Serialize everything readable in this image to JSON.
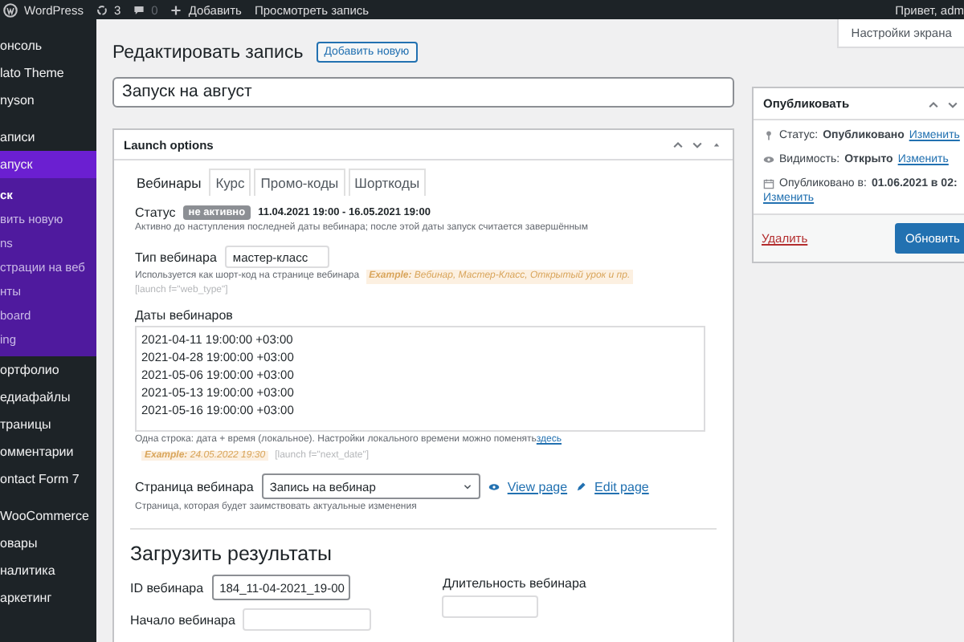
{
  "admin_bar": {
    "site": "WordPress",
    "updates": "3",
    "comments": "0",
    "add": "Добавить",
    "view": "Просмотреть запись",
    "greeting": "Привет, adm"
  },
  "sidebar": {
    "groups": [
      {
        "items": [
          {
            "label": "онсоль",
            "selected": false
          },
          {
            "label": "lato Theme",
            "selected": false
          },
          {
            "label": "nyson",
            "selected": false
          }
        ]
      },
      {
        "items": [
          {
            "label": "аписи",
            "selected": false
          },
          {
            "label": "апуск",
            "selected": true,
            "children": [
              {
                "label": "ск",
                "selected": true
              },
              {
                "label": "вить новую",
                "selected": false
              },
              {
                "label": "ns",
                "selected": false
              },
              {
                "label": "страции на веб",
                "selected": false
              },
              {
                "label": "нты",
                "selected": false
              },
              {
                "label": "board",
                "selected": false
              },
              {
                "label": "ing",
                "selected": false
              }
            ]
          },
          {
            "label": "ортфолио",
            "selected": false
          },
          {
            "label": "едиафайлы",
            "selected": false
          },
          {
            "label": "траницы",
            "selected": false
          },
          {
            "label": "омментарии",
            "selected": false
          },
          {
            "label": "ontact Form 7",
            "selected": false
          }
        ]
      },
      {
        "items": [
          {
            "label": "WooCommerce",
            "selected": false
          },
          {
            "label": "овары",
            "selected": false
          },
          {
            "label": "налитика",
            "selected": false
          },
          {
            "label": "аркетинг",
            "selected": false
          }
        ]
      }
    ]
  },
  "screen_options": "Настройки экрана",
  "page_title": "Редактировать запись",
  "add_new": "Добавить новую",
  "post_title": "Запуск на август",
  "launch_box": {
    "title": "Launch options",
    "tabs": [
      {
        "label": "Вебинары",
        "selected": true
      },
      {
        "label": "Курс",
        "selected": false
      },
      {
        "label": "Промо-коды",
        "selected": false
      },
      {
        "label": "Шорткоды",
        "selected": false
      }
    ],
    "status": {
      "label": "Статус",
      "badge": "не активно",
      "range": "11.04.2021 19:00 - 16.05.2021 19:00",
      "note": "Активно до наступления последней даты вебинара; после этой даты запуск считается завершённым"
    },
    "type": {
      "label": "Тип вебинара",
      "value": "мастер-класс",
      "note": "Используется как шорт-код на странице вебинара",
      "example": "**Example:** Вебинар, Мастер-Класс, Открытый урок и пр.",
      "shortcode": "[launch f=\"web_type\"]"
    },
    "dates": {
      "label": "Даты вебинаров",
      "values": [
        "2021-04-11 19:00:00 +03:00",
        "2021-04-28 19:00:00 +03:00",
        "2021-05-06 19:00:00 +03:00",
        "2021-05-13 19:00:00 +03:00",
        "2021-05-16 19:00:00 +03:00"
      ],
      "note": "Одна строка: дата + время (локальное). Настройки локального времени можно поменять",
      "link": "здесь",
      "example": "**Example:** 24.05.2022 19:30",
      "shortcode": "[launch f=\"next_date\"]"
    },
    "page": {
      "label": "Страница вебинара",
      "value": "Запись на вебинар",
      "view": "View page",
      "edit": "Edit page",
      "note": "Страница, которая будет заимствовать актуальные изменения"
    },
    "results": {
      "heading": "Загрузить результаты",
      "id_label": "ID вебинара",
      "id_value": "184_11-04-2021_19-00",
      "start_label": "Начало вебинара",
      "duration_label": "Длительность вебинара"
    }
  },
  "publish": {
    "title": "Опубликовать",
    "status_label": "Статус:",
    "status": "Опубликовано",
    "visibility_label": "Видимость:",
    "visibility": "Открыто",
    "published_label": "Опубликовано в:",
    "published": "01.06.2021 в 02:",
    "change_status": "Изменить",
    "change_visibility": "Изменить",
    "change_date": "Изменить",
    "delete": "Удалить",
    "update": "Обновить"
  }
}
